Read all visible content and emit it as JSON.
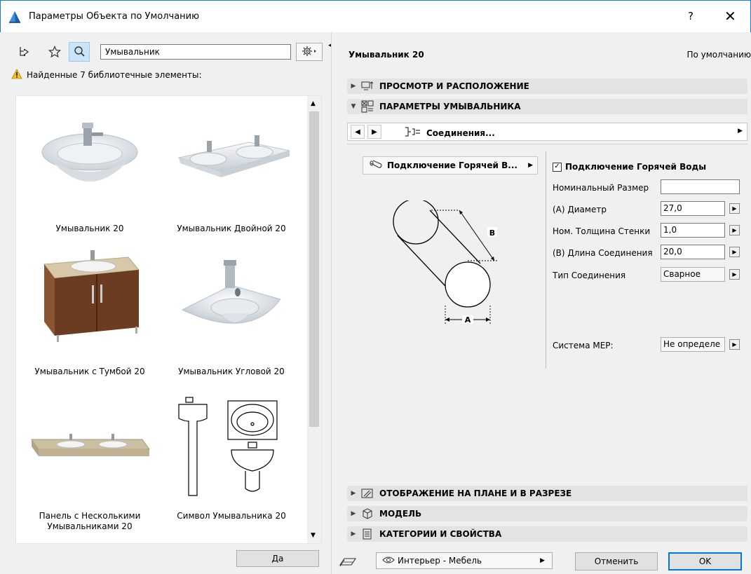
{
  "window": {
    "title": "Параметры Объекта по Умолчанию",
    "help": "?",
    "close": "✕"
  },
  "left": {
    "search_value": "Умывальник",
    "found_text": "Найденные 7 библиотечные элементы:",
    "items": [
      {
        "label": "Умывальник 20"
      },
      {
        "label": "Умывальник Двойной 20"
      },
      {
        "label": "Умывальник с Тумбой 20"
      },
      {
        "label": "Умывальник Угловой 20"
      },
      {
        "label": "Панель с Несколькими Умывальниками 20"
      },
      {
        "label": "Символ Умывальника 20"
      }
    ],
    "ok_label": "Да"
  },
  "right": {
    "object_name": "Умывальник 20",
    "default_label": "По умолчанию",
    "sections": {
      "view": "ПРОСМОТР И РАСПОЛОЖЕНИЕ",
      "params": "ПАРАМЕТРЫ УМЫВАЛЬНИКА",
      "plan": "ОТОБРАЖЕНИЕ НА ПЛАНЕ И В РАЗРЕЗЕ",
      "model": "МОДЕЛЬ",
      "categories": "КАТЕГОРИИ И СВОЙСТВА"
    },
    "nav_label": "Соединения...",
    "hot_button": "Подключение Горячей В...",
    "checkbox_label": "Подключение Горячей Воды",
    "diagram": {
      "label_a": "A",
      "label_b": "B"
    },
    "params": [
      {
        "label": "Номинальный Размер",
        "value": ""
      },
      {
        "label": "(A) Диаметр",
        "value": "27,0"
      },
      {
        "label": "Ном. Толщина Стенки",
        "value": "1,0"
      },
      {
        "label": "(B) Длина Соединения",
        "value": "20,0"
      },
      {
        "label": "Тип Соединения",
        "value": "Сварное"
      }
    ],
    "mep_label": "Система MEP:",
    "mep_value": "Не определе",
    "layer": "Интерьер - Мебель",
    "cancel_label": "Отменить",
    "ok_label": "OK"
  },
  "colors": {
    "accent": "#0078d7",
    "section_bg": "#e3e3e3",
    "window_border": "#1979ca"
  }
}
